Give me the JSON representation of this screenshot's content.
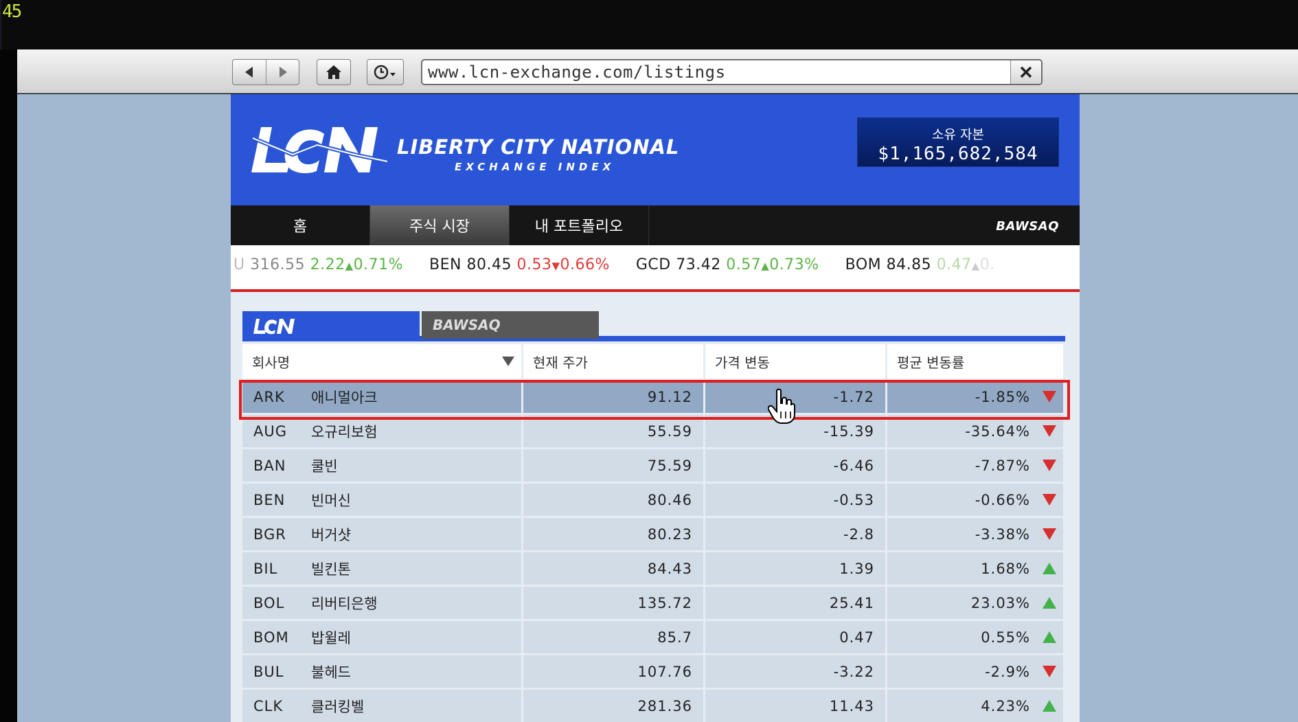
{
  "hud": {
    "fps": "45"
  },
  "browser": {
    "url": "www.lcn-exchange.com/listings"
  },
  "site": {
    "brand_title": "LIBERTY CITY NATIONAL",
    "brand_subtitle": "EXCHANGE INDEX",
    "capital": {
      "label": "소유 자본",
      "value": "$1,165,682,584"
    },
    "nav": {
      "home": "홈",
      "market": "주식 시장",
      "portfolio": "내 포트폴리오",
      "bawsaq": "BAWSAQ"
    },
    "ticker": [
      {
        "symbol": "U",
        "price": "316.55",
        "change": "2.22",
        "pct": "0.71%",
        "dir": "up"
      },
      {
        "symbol": "BEN",
        "price": "80.45",
        "change": "0.53",
        "pct": "0.66%",
        "dir": "down"
      },
      {
        "symbol": "GCD",
        "price": "73.42",
        "change": "0.57",
        "pct": "0.73%",
        "dir": "up"
      },
      {
        "symbol": "BOM",
        "price": "84.85",
        "change": "0.47",
        "pct": "0.",
        "dir": "up"
      }
    ],
    "exchange_tabs": {
      "lcn": "LCN",
      "bawsaq": "BAWSAQ"
    },
    "table": {
      "headers": {
        "name": "회사명",
        "price": "현재 주가",
        "change": "가격 변동",
        "avg": "평균 변동률"
      },
      "rows": [
        {
          "symbol": "ARK",
          "name": "애니멀아크",
          "price": "91.12",
          "change": "-1.72",
          "avg": "-1.85%",
          "dir": "down",
          "selected": true
        },
        {
          "symbol": "AUG",
          "name": "오규리보험",
          "price": "55.59",
          "change": "-15.39",
          "avg": "-35.64%",
          "dir": "down"
        },
        {
          "symbol": "BAN",
          "name": "쿨빈",
          "price": "75.59",
          "change": "-6.46",
          "avg": "-7.87%",
          "dir": "down"
        },
        {
          "symbol": "BEN",
          "name": "빈머신",
          "price": "80.46",
          "change": "-0.53",
          "avg": "-0.66%",
          "dir": "down"
        },
        {
          "symbol": "BGR",
          "name": "버거샷",
          "price": "80.23",
          "change": "-2.8",
          "avg": "-3.38%",
          "dir": "down"
        },
        {
          "symbol": "BIL",
          "name": "빌킨톤",
          "price": "84.43",
          "change": "1.39",
          "avg": "1.68%",
          "dir": "up"
        },
        {
          "symbol": "BOL",
          "name": "리버티은행",
          "price": "135.72",
          "change": "25.41",
          "avg": "23.03%",
          "dir": "up"
        },
        {
          "symbol": "BOM",
          "name": "밥윌레",
          "price": "85.7",
          "change": "0.47",
          "avg": "0.55%",
          "dir": "up"
        },
        {
          "symbol": "BUL",
          "name": "불헤드",
          "price": "107.76",
          "change": "-3.22",
          "avg": "-2.9%",
          "dir": "down"
        },
        {
          "symbol": "CLK",
          "name": "클러킹벨",
          "price": "281.36",
          "change": "11.43",
          "avg": "4.23%",
          "dir": "up"
        }
      ]
    }
  },
  "colors": {
    "brand_blue": "#2a55d6",
    "up": "#44b14a",
    "down": "#d72e2e",
    "highlight": "#e01c1c"
  }
}
